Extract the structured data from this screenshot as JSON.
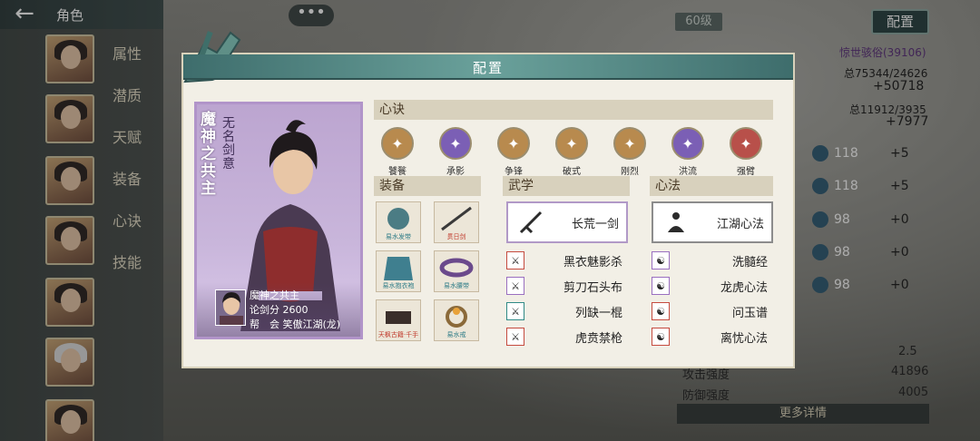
{
  "topbar": {
    "back_icon": "back-arrow-icon",
    "title": "角色",
    "ellipsis": "•••"
  },
  "sidebar": {
    "tabs": [
      {
        "label": "属性"
      },
      {
        "label": "潜质"
      },
      {
        "label": "天赋"
      },
      {
        "label": "装备"
      },
      {
        "label": "心诀"
      },
      {
        "label": "技能"
      }
    ]
  },
  "right_panel": {
    "level": "60级",
    "config_button": "配置",
    "sect_name": "惊世骇俗(39106)",
    "total1": "总75344/24626",
    "big1": "+50718",
    "total2": "总11912/3935",
    "big2": "+7977",
    "rows": [
      {
        "value": "118",
        "plus": "+5"
      },
      {
        "value": "118",
        "plus": "+5"
      },
      {
        "value": "98",
        "plus": "+0"
      },
      {
        "value": "98",
        "plus": "+0"
      },
      {
        "value": "98",
        "plus": "+0"
      }
    ],
    "lower": [
      {
        "label": "",
        "value": "2.5"
      },
      {
        "label": "攻击强度",
        "value": "41896"
      },
      {
        "label": "防御强度",
        "value": "4005"
      }
    ],
    "more_details": "更多详情"
  },
  "modal": {
    "title": "配置",
    "character": {
      "title": "魔神之共主",
      "subtitle": "无名剑意",
      "name": "魔神之共主",
      "score_label": "论剑分",
      "score": "2600",
      "guild_label": "帮　会",
      "guild": "笑傲江湖(龙)"
    },
    "sections": {
      "xinjue": "心诀",
      "equipment": "装备",
      "wuxue": "武学",
      "xinfa": "心法"
    },
    "skills": [
      {
        "label": "饕餮",
        "color": "#b88a4e"
      },
      {
        "label": "承影",
        "color": "#7b5fb5"
      },
      {
        "label": "争锋",
        "color": "#b88a4e"
      },
      {
        "label": "破式",
        "color": "#b88a4e"
      },
      {
        "label": "刚烈",
        "color": "#b88a4e"
      },
      {
        "label": "洪流",
        "color": "#7b5fb5"
      },
      {
        "label": "强臂",
        "color": "#b8504a"
      }
    ],
    "equipment": [
      {
        "label": "易水发带",
        "style": "teal"
      },
      {
        "label": "贯日剑",
        "style": "red"
      },
      {
        "label": "易水抱衣袍",
        "style": "teal"
      },
      {
        "label": "易水腰带",
        "style": "teal"
      },
      {
        "label": "天枫古籍·千手",
        "style": "red"
      },
      {
        "label": "易水戒",
        "style": "teal"
      }
    ],
    "wuxue": {
      "main": "长荒一剑",
      "list": [
        {
          "name": "黑衣魅影杀",
          "style": "red"
        },
        {
          "name": "剪刀石头布",
          "style": "purple"
        },
        {
          "name": "列缺一棍",
          "style": "teal"
        },
        {
          "name": "虎贲禁枪",
          "style": "red"
        }
      ]
    },
    "xinfa": {
      "main": "江湖心法",
      "list": [
        {
          "name": "洗髓经",
          "style": "purple"
        },
        {
          "name": "龙虎心法",
          "style": "purple"
        },
        {
          "name": "问玉谱",
          "style": "red"
        },
        {
          "name": "离忧心法",
          "style": "red"
        }
      ]
    }
  }
}
